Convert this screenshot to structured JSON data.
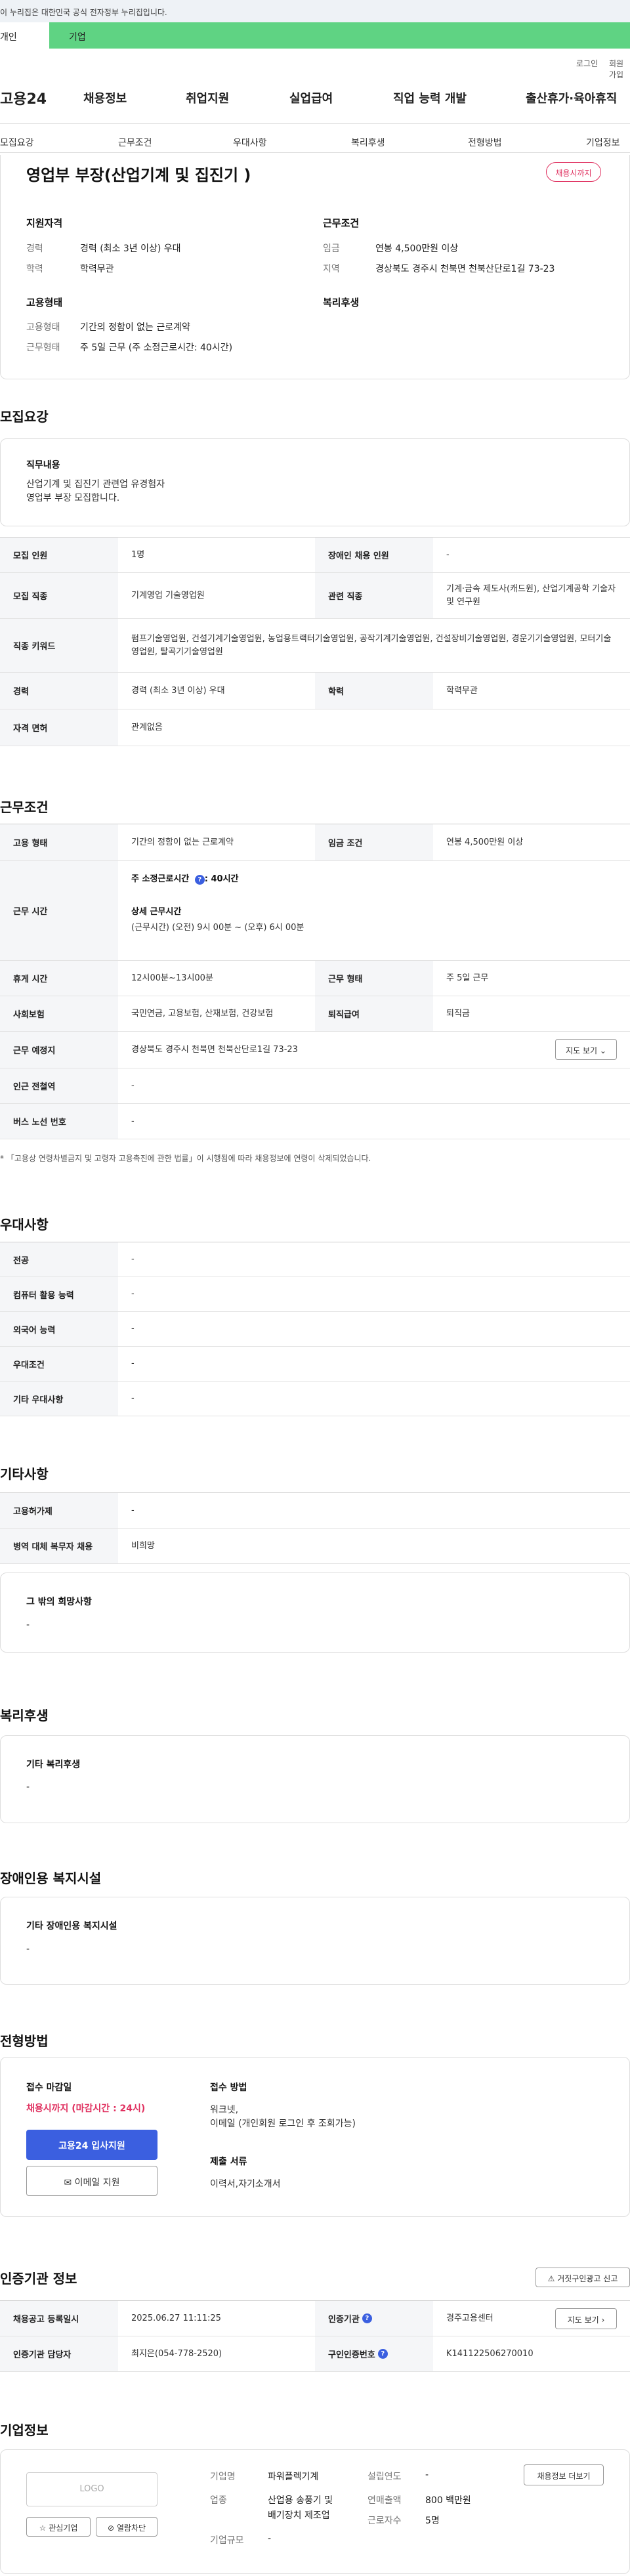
{
  "header": {
    "gov_banner": "이 누리집은 대한민국 공식 전자정부 누리집입니다.",
    "tab_personal": "개인",
    "tab_company": "기업",
    "login": "로그인",
    "join": "회원가입",
    "logo": "고용24",
    "gnb": [
      "채용정보",
      "취업지원",
      "실업급여",
      "직업 능력 개발",
      "출산휴가·육아휴직"
    ]
  },
  "subnav": [
    "모집요강",
    "근무조건",
    "우대사항",
    "복리후생",
    "전형방법",
    "기업정보"
  ],
  "summary": {
    "title": "영업부 부장(산업기계 및 집진기 )",
    "closing_badge": "채용시까지",
    "qual_title": "지원자격",
    "career_label": "경력",
    "career_value": "경력 (최소 3년 이상) 우대",
    "edu_label": "학력",
    "edu_value": "학력무관",
    "cond_title": "근무조건",
    "wage_label": "임금",
    "wage_value": "연봉 4,500만원 이상",
    "region_label": "지역",
    "region_value": "경상북도 경주시 천북면 천북산단로1길 73-23",
    "emp_title": "고용형태",
    "emp_type_label": "고용형태",
    "emp_type_value": "기간의 정함이 없는 근로계약",
    "work_type_label": "근무형태",
    "work_type_value": "주 5일 근무 (주 소정근로시간: 40시간)",
    "welfare_title": "복리후생"
  },
  "recruit": {
    "section_title": "모집요강",
    "duty_title": "직무내용",
    "duty_lines": [
      "산업기계 및 집진기 관련업 유경험자",
      "영업부 부장 모집합니다."
    ],
    "rows": {
      "headcount_label": "모집 인원",
      "headcount_value": "1명",
      "disabled_label": "장애인 채용 인원",
      "disabled_value": "-",
      "job_label": "모집 직종",
      "job_value": "기계영업 기술영업원",
      "related_label": "관련 직종",
      "related_value": "기계·금속 제도사(캐드원), 산업기계공학 기술자 및 연구원",
      "keyword_label": "직종 키워드",
      "keyword_value": "펌프기술영업원, 건설기계기술영업원, 농업용트랙터기술영업원, 공작기계기술영업원, 건설장비기술영업원, 경운기기술영업원, 모터기술영업원, 탈곡기기술영업원",
      "career_label": "경력",
      "career_value": "경력 (최소 3년 이상) 우대",
      "edu_label": "학력",
      "edu_value": "학력무관",
      "license_label": "자격 면허",
      "license_value": "관계없음"
    }
  },
  "conditions": {
    "section_title": "근무조건",
    "emp_label": "고용 형태",
    "emp_value": "기간의 정함이 없는 근로계약",
    "wage_label": "임금 조건",
    "wage_value": "연봉 4,500만원 이상",
    "hours_label": "근무 시간",
    "hours_weekly": "주 소정근로시간 ",
    "hours_weekly_value": ": 40시간",
    "hours_detail_title": "상세 근무시간",
    "hours_detail": "(근무시간) (오전) 9시 00분 ~ (오후) 6시 00분",
    "break_label": "휴게 시간",
    "break_value": "12시00분~13시00분",
    "worktype_label": "근무 형태",
    "worktype_value": "주 5일 근무",
    "insurance_label": "사회보험",
    "insurance_value": "국민연금, 고용보험, 산재보험, 건강보험",
    "retire_label": "퇴직급여",
    "retire_value": "퇴직금",
    "place_label": "근무 예정지",
    "place_value": "경상북도 경주시 천북면 천북산단로1길 73-23",
    "map_button": "지도 보기",
    "station_label": "인근 전철역",
    "station_value": "-",
    "bus_label": "버스 노선 번호",
    "bus_value": "-",
    "note": "「고용상 연령차별금지 및 고령자 고용촉진에 관한 법률」이 시행됨에 따라 채용정보에 연령이 삭제되었습니다."
  },
  "preference": {
    "section_title": "우대사항",
    "rows": [
      {
        "label": "전공",
        "value": "-"
      },
      {
        "label": "컴퓨터 활용 능력",
        "value": "-"
      },
      {
        "label": "외국어 능력",
        "value": "-"
      },
      {
        "label": "우대조건",
        "value": "-"
      },
      {
        "label": "기타 우대사항",
        "value": "-"
      }
    ]
  },
  "other": {
    "section_title": "기타사항",
    "rows": [
      {
        "label": "고용허가제",
        "value": "-"
      },
      {
        "label": "병역 대체 복무자 채용",
        "value": "비희망"
      }
    ],
    "extra_title": "그 밖의 희망사항",
    "extra_value": "-"
  },
  "welfare": {
    "section_title": "복리후생",
    "box_title": "기타 복리후생",
    "box_value": "-"
  },
  "facility": {
    "section_title": "장애인용 복지시설",
    "box_title": "기타 장애인용 복지시설",
    "box_value": "-"
  },
  "selection": {
    "section_title": "전형방법",
    "deadline_title": "접수 마감일",
    "deadline_value": "채용시까지 (마감시간 : 24시)",
    "apply_button": "고용24 입사지원",
    "email_button": "이메일 지원",
    "method_title": "접수 방법",
    "method_lines": [
      "워크넷,",
      "이메일 (개인회원 로그인 후 조회가능)"
    ],
    "docs_title": "제출 서류",
    "docs_value": "이력서,자기소개서"
  },
  "cert": {
    "section_title": "인증기관 정보",
    "report_button": "거짓구인광고 신고",
    "reg_date_label": "채용공고 등록일시",
    "reg_date_value": "2025.06.27 11:11:25",
    "agency_label": "인증기관",
    "agency_value": "경주고용센터",
    "map_button": "지도 보기",
    "manager_label": "인증기관 담당자",
    "manager_value": "최지은(054-778-2520)",
    "cert_no_label": "구인인증번호",
    "cert_no_value": "K141122506270010"
  },
  "company": {
    "section_title": "기업정보",
    "logo_placeholder": "LOGO",
    "fav_button": "관심기업",
    "block_button": "열람차단",
    "name_label": "기업명",
    "name_value": "파워플렉기계",
    "industry_label": "업종",
    "industry_value_1": "산업용 송풍기 및",
    "industry_value_2": "배기장치 제조업",
    "size_label": "기업규모",
    "size_value": "-",
    "founded_label": "설립연도",
    "founded_value": "-",
    "sales_label": "연매출액",
    "sales_value": "800 백만원",
    "staff_label": "근로자수",
    "staff_value": "5명",
    "more_button": "채용정보 더보기"
  },
  "colors": {
    "accent_green": "#5fd383",
    "primary_blue": "#3b5fe0",
    "deadline_pink": "#e0305f"
  }
}
